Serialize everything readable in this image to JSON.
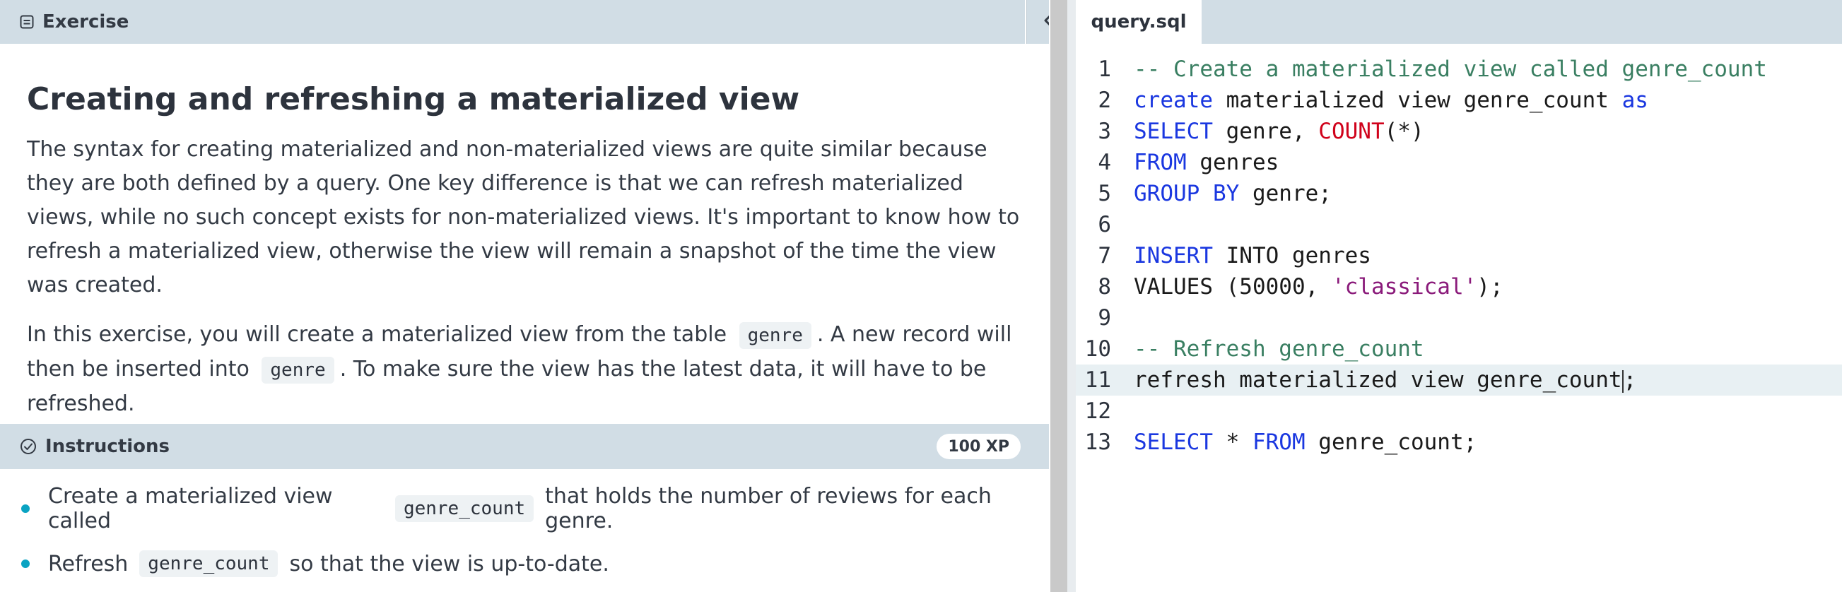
{
  "left_panel": {
    "header_title": "Exercise",
    "page_title": "Creating and refreshing a materialized view",
    "paragraph1": "The syntax for creating materialized and non-materialized views are quite similar because they are both defined by a query. One key difference is that we can refresh materialized views, while no such concept exists for non-materialized views. It's important to know how to refresh a materialized view, otherwise the view will remain a snapshot of the time the view was created.",
    "paragraph2": {
      "part1": "In this exercise, you will create a materialized view from the table",
      "code1": "genre",
      "part2": ". A new record will then be inserted into",
      "code2": "genre",
      "part3": ". To make sure the view has the latest data, it will have to be refreshed."
    }
  },
  "instructions": {
    "header_title": "Instructions",
    "xp": "100 XP",
    "items": [
      {
        "before": "Create a materialized view called",
        "code": "genre_count",
        "after": "that holds the number of reviews for each genre."
      },
      {
        "before": "Refresh",
        "code": "genre_count",
        "after": "so that the view is up-to-date."
      }
    ]
  },
  "editor": {
    "tab_label": "query.sql",
    "active_line": 11,
    "lines": [
      {
        "n": "1",
        "tokens": [
          {
            "t": "-- Create a materialized view called genre_count",
            "c": "comment"
          }
        ]
      },
      {
        "n": "2",
        "tokens": [
          {
            "t": "create",
            "c": "kw"
          },
          {
            "t": " materialized view genre_count ",
            "c": "plain"
          },
          {
            "t": "as",
            "c": "kw"
          }
        ]
      },
      {
        "n": "3",
        "tokens": [
          {
            "t": "SELECT",
            "c": "kw"
          },
          {
            "t": " genre, ",
            "c": "plain"
          },
          {
            "t": "COUNT",
            "c": "fn"
          },
          {
            "t": "(*)",
            "c": "plain"
          }
        ]
      },
      {
        "n": "4",
        "tokens": [
          {
            "t": "FROM",
            "c": "kw"
          },
          {
            "t": " genres",
            "c": "plain"
          }
        ]
      },
      {
        "n": "5",
        "tokens": [
          {
            "t": "GROUP BY",
            "c": "kw"
          },
          {
            "t": " genre;",
            "c": "plain"
          }
        ]
      },
      {
        "n": "6",
        "tokens": []
      },
      {
        "n": "7",
        "tokens": [
          {
            "t": "INSERT",
            "c": "kw"
          },
          {
            "t": " INTO genres",
            "c": "plain"
          }
        ]
      },
      {
        "n": "8",
        "tokens": [
          {
            "t": "VALUES (50000, ",
            "c": "plain"
          },
          {
            "t": "'classical'",
            "c": "str"
          },
          {
            "t": ");",
            "c": "plain"
          }
        ]
      },
      {
        "n": "9",
        "tokens": []
      },
      {
        "n": "10",
        "tokens": [
          {
            "t": "-- Refresh genre_count",
            "c": "comment"
          }
        ]
      },
      {
        "n": "11",
        "tokens": [
          {
            "t": "refresh materialized view genre_count",
            "c": "plain"
          },
          {
            "t": "|",
            "c": "cursor"
          },
          {
            "t": ";",
            "c": "plain"
          }
        ]
      },
      {
        "n": "12",
        "tokens": []
      },
      {
        "n": "13",
        "tokens": [
          {
            "t": "SELECT",
            "c": "kw"
          },
          {
            "t": " * ",
            "c": "plain"
          },
          {
            "t": "FROM",
            "c": "kw"
          },
          {
            "t": " genre_count;",
            "c": "plain"
          }
        ]
      }
    ]
  },
  "icons": {
    "exercise": "document-icon",
    "instructions": "check-circle-icon",
    "collapse": "chevron-left-icon"
  }
}
